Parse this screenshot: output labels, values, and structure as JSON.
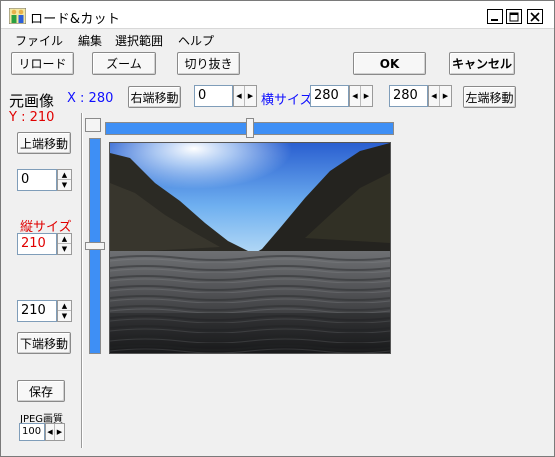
{
  "window": {
    "title": "ロード&カット"
  },
  "menu": [
    "ファイル",
    "編集",
    "選択範囲",
    "ヘルプ"
  ],
  "toolbar": {
    "reload": "リロード",
    "zoom": "ズーム",
    "crop": "切り抜き",
    "ok": "OK",
    "cancel": "キャンセル"
  },
  "info": {
    "original_label": "元画像",
    "x_text": "X : 280",
    "y_text": "Y : 210"
  },
  "horizontal": {
    "right_move": "右端移動",
    "right_value": "0",
    "width_label": "横サイズ",
    "width_value": "280",
    "left_value": "280",
    "left_move": "左端移動"
  },
  "vertical": {
    "top_move": "上端移動",
    "top_value": "0",
    "height_label": "縦サイズ",
    "height_value": "210",
    "bottom_value": "210",
    "bottom_move": "下端移動"
  },
  "save": {
    "label": "保存",
    "jpeg_label": "JPEG画質",
    "quality": "100"
  },
  "sliders": {
    "horizontal_fraction": 0.5,
    "vertical_fraction": 0.5
  },
  "colors": {
    "slider_fill": "#3e8ff5",
    "x_text": "#1010ff",
    "y_text": "#e00000"
  },
  "icons": {
    "app": "people-icon",
    "minimize": "minimize-icon",
    "maximize": "maximize-icon",
    "close": "close-icon"
  }
}
